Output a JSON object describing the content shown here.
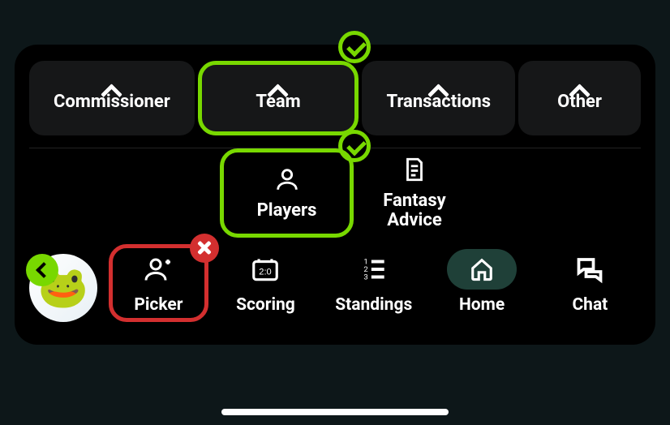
{
  "topMenu": {
    "commissioner": "Commissioner",
    "team": "Team",
    "transactions": "Transactions",
    "other": "Other"
  },
  "midMenu": {
    "players": "Players",
    "fantasyAdvice": "Fantasy\nAdvice"
  },
  "nav": {
    "picker": "Picker",
    "scoring": "Scoring",
    "standings": "Standings",
    "home": "Home",
    "chat": "Chat"
  },
  "highlights": {
    "teamSelected": true,
    "playersSelected": true,
    "pickerRejected": true
  },
  "colors": {
    "accent": "#78d800",
    "danger": "#d32f2f",
    "bg": "#0d1719",
    "card": "#161718"
  }
}
